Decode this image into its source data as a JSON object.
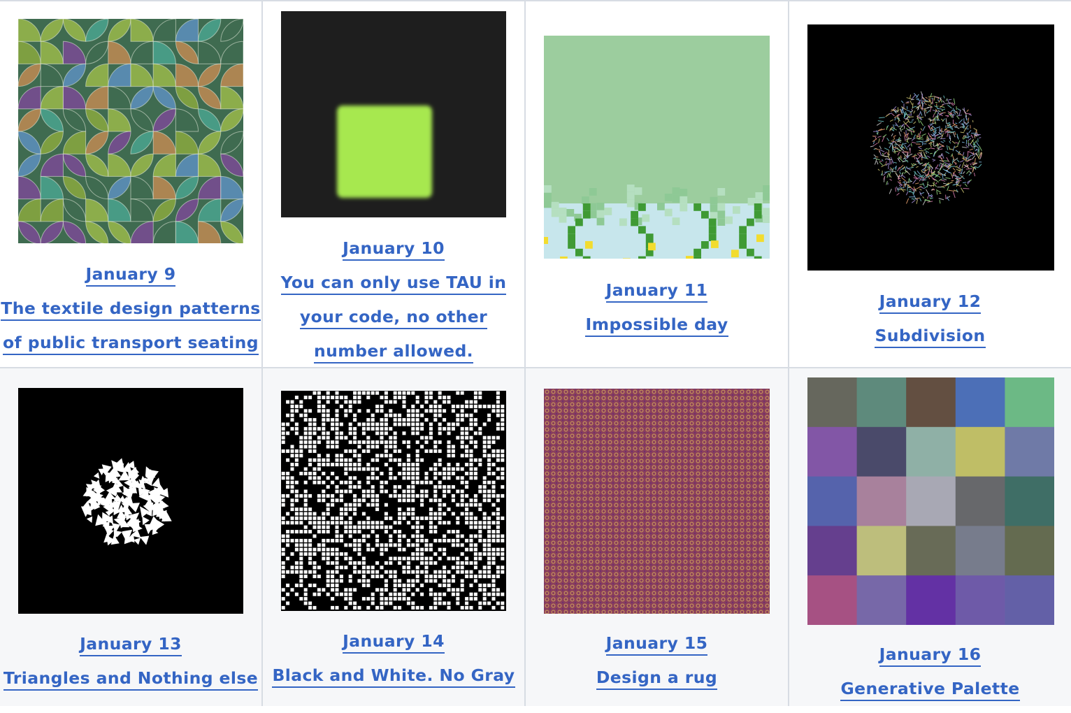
{
  "items": [
    {
      "date": "January 9",
      "title_lines": [
        "The textile design patterns",
        "of public transport seating"
      ]
    },
    {
      "date": "January 10",
      "title_lines": [
        "You can only use TAU in",
        "your code, no other",
        "number allowed."
      ]
    },
    {
      "date": "January 11",
      "title_lines": [
        "Impossible day"
      ]
    },
    {
      "date": "January 12",
      "title_lines": [
        "Subdivision"
      ]
    },
    {
      "date": "January 13",
      "title_lines": [
        "Triangles and Nothing else"
      ]
    },
    {
      "date": "January 14",
      "title_lines": [
        "Black and White. No Gray"
      ]
    },
    {
      "date": "January 15",
      "title_lines": [
        "Design a rug"
      ]
    },
    {
      "date": "January 16",
      "title_lines": [
        "Generative Palette"
      ]
    }
  ],
  "colors": {
    "link": "#3465c4",
    "grid_line": "#d7dce3",
    "row2_bg": "#f6f7f9"
  },
  "palette_grid": [
    [
      "#66675d",
      "#5e8a7c",
      "#634f41",
      "#4c6fb7",
      "#6cb985"
    ],
    [
      "#8256a6",
      "#4a4a6a",
      "#8fb0a6",
      "#bfbe66",
      "#6f7aa7"
    ],
    [
      "#5563ac",
      "#a8819c",
      "#a8a8b4",
      "#67686b",
      "#3f6e66"
    ],
    [
      "#653f8e",
      "#bdbe7c",
      "#686b57",
      "#777c8c",
      "#646b50"
    ],
    [
      "#a65183",
      "#7768a8",
      "#6331a4",
      "#6e5aa8",
      "#6360a7"
    ]
  ]
}
